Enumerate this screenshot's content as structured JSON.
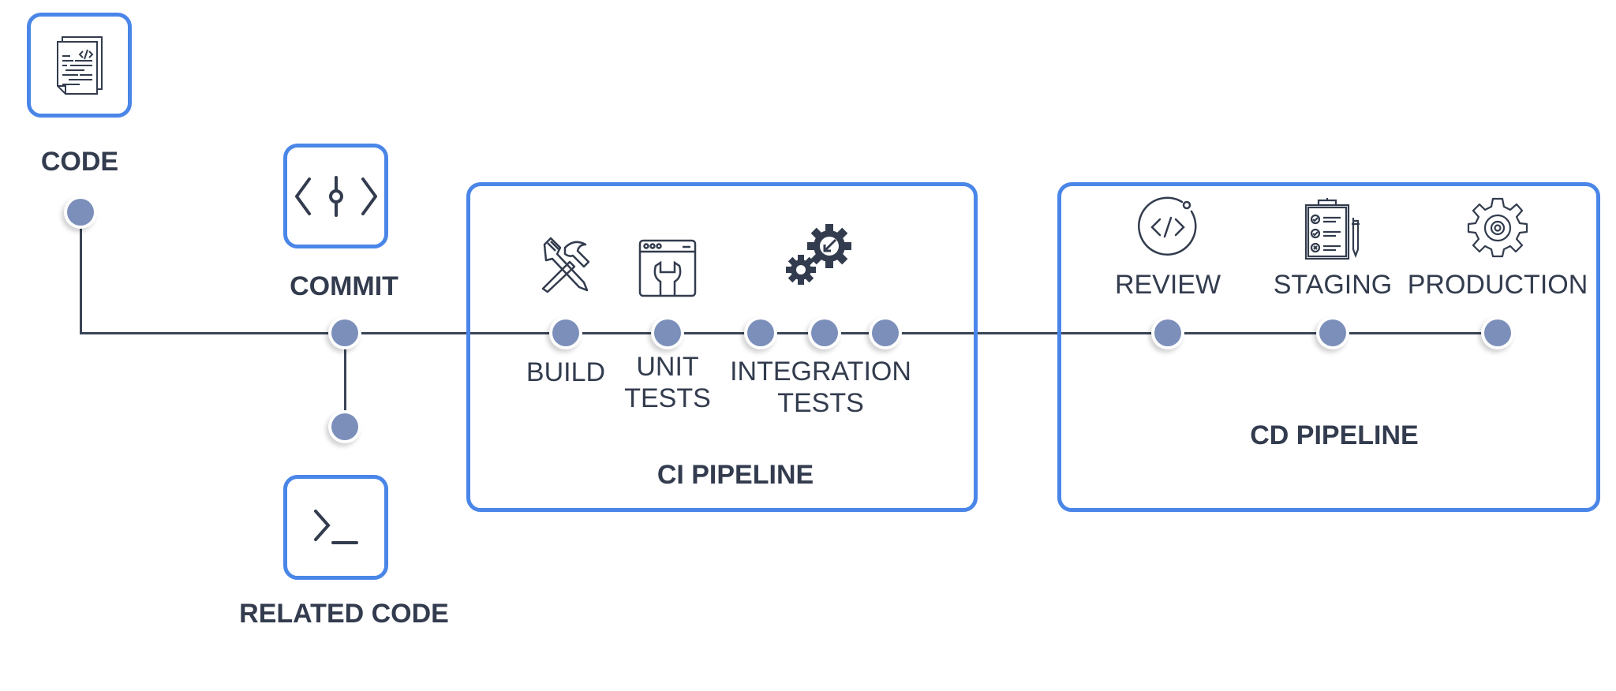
{
  "colors": {
    "accent": "#4a86e8",
    "node": "#7b8fba",
    "line": "#3a4556",
    "text": "#333c4e"
  },
  "nodes": {
    "code": {
      "label": "CODE",
      "icon": "code-file-icon"
    },
    "commit": {
      "label": "COMMIT",
      "icon": "git-commit-icon"
    },
    "related": {
      "label": "RELATED CODE",
      "icon": "terminal-icon"
    }
  },
  "ci": {
    "title": "CI PIPELINE",
    "stages": [
      {
        "label": "BUILD",
        "icon": "tools-icon"
      },
      {
        "label_lines": [
          "UNIT",
          "TESTS"
        ],
        "icon": "browser-wrench-icon"
      },
      {
        "label_lines": [
          "INTEGRATION",
          "TESTS"
        ],
        "icon": "gears-icon"
      }
    ]
  },
  "cd": {
    "title": "CD PIPELINE",
    "stages": [
      {
        "label": "REVIEW",
        "icon": "code-review-icon"
      },
      {
        "label": "STAGING",
        "icon": "checklist-icon"
      },
      {
        "label": "PRODUCTION",
        "icon": "gear-icon"
      }
    ]
  }
}
